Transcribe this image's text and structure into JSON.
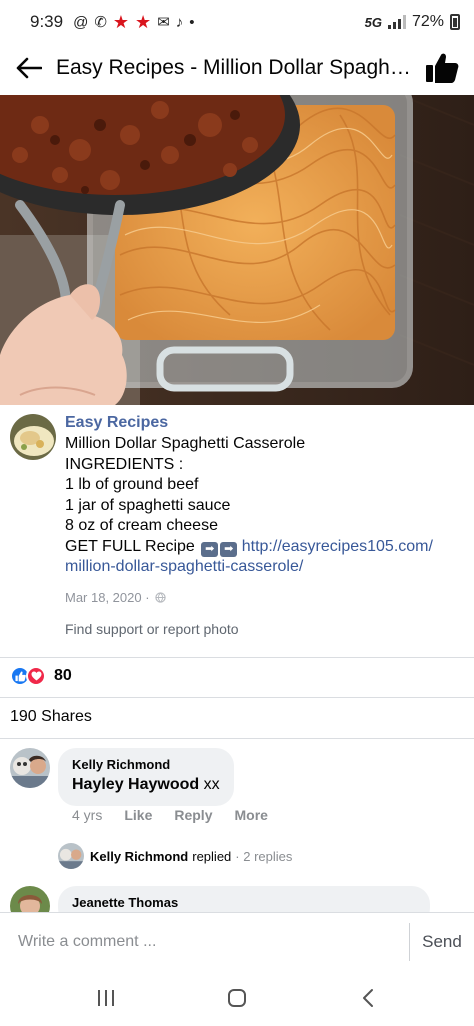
{
  "status_bar": {
    "time": "9:39",
    "network": "5G",
    "battery": "72%"
  },
  "header": {
    "title": "Easy Recipes - Million Dollar Spaghet..."
  },
  "post": {
    "page_name": "Easy Recipes",
    "lines": [
      "Million Dollar Spaghetti Casserole",
      "INGREDIENTS :",
      "1 lb of ground beef",
      "1 jar of spaghetti sauce",
      "8 oz of cream cheese"
    ],
    "cta_text": "GET FULL Recipe",
    "link_line1": "http://easyrecipes105.com/",
    "link_line2": "million-dollar-spaghetti-casserole/",
    "date": "Mar 18, 2020 ·",
    "report": "Find support or report photo"
  },
  "engagement": {
    "reaction_count": "80",
    "shares": "190 Shares"
  },
  "comments": [
    {
      "author": "Kelly Richmond",
      "mention": "Hayley Haywood",
      "text": " xx",
      "time": "4 yrs",
      "like": "Like",
      "reply": "Reply",
      "more": "More"
    },
    {
      "author": "Jeanette Thomas"
    }
  ],
  "reply_summary": {
    "author": "Kelly Richmond",
    "verb": "replied",
    "count": "· 2 replies"
  },
  "composer": {
    "placeholder": "Write a comment ...",
    "send_label": "Send"
  },
  "colors": {
    "link": "#385898",
    "page_name": "#4b67a1",
    "like_blue": "#1877f2",
    "love_red": "#f02849",
    "notification_red": "#d9151e"
  }
}
